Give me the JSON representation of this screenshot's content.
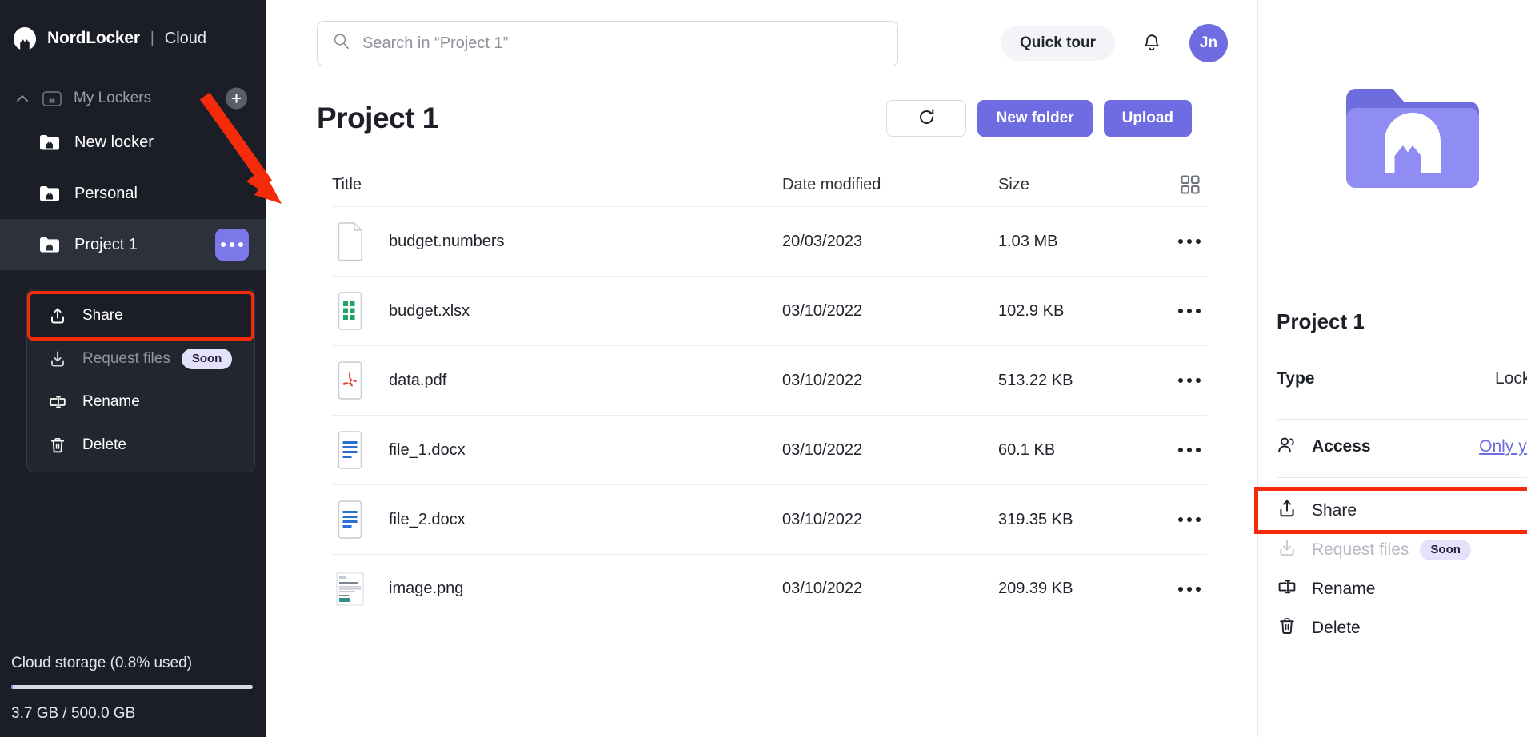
{
  "brand": {
    "name": "NordLocker",
    "separator": "|",
    "product": "Cloud"
  },
  "sidebar": {
    "group": {
      "label": "My Lockers",
      "add_tooltip": "+"
    },
    "lockers": [
      {
        "label": "New locker",
        "active": false
      },
      {
        "label": "Personal",
        "active": false
      },
      {
        "label": "Project 1",
        "active": true
      }
    ],
    "context_menu": [
      {
        "label": "Share",
        "icon": "share-icon",
        "highlighted": true,
        "disabled": false
      },
      {
        "label": "Request files",
        "icon": "download-icon",
        "badge": "Soon",
        "highlighted": false,
        "disabled": true
      },
      {
        "label": "Rename",
        "icon": "rename-icon",
        "highlighted": false,
        "disabled": false
      },
      {
        "label": "Delete",
        "icon": "trash-icon",
        "highlighted": false,
        "disabled": false
      }
    ],
    "storage": {
      "title": "Cloud storage (0.8% used)",
      "used": "3.7 GB",
      "total": "500.0 GB",
      "summary": "3.7 GB / 500.0 GB",
      "percent": 0.8
    }
  },
  "topbar": {
    "search_placeholder": "Search in “Project 1”",
    "search_value": "",
    "quick_tour": "Quick tour",
    "avatar_initials": "Jn"
  },
  "page": {
    "title": "Project 1",
    "refresh_label": "",
    "new_folder_label": "New folder",
    "upload_label": "Upload"
  },
  "table": {
    "columns": [
      "Title",
      "Date modified",
      "Size"
    ],
    "rows": [
      {
        "name": "budget.numbers",
        "date": "20/03/2023",
        "size": "1.03 MB",
        "icon": "numbers-file-icon"
      },
      {
        "name": "budget.xlsx",
        "date": "03/10/2022",
        "size": "102.9 KB",
        "icon": "xlsx-file-icon"
      },
      {
        "name": "data.pdf",
        "date": "03/10/2022",
        "size": "513.22 KB",
        "icon": "pdf-file-icon"
      },
      {
        "name": "file_1.docx",
        "date": "03/10/2022",
        "size": "60.1 KB",
        "icon": "docx-file-icon"
      },
      {
        "name": "file_2.docx",
        "date": "03/10/2022",
        "size": "319.35 KB",
        "icon": "docx-file-icon"
      },
      {
        "name": "image.png",
        "date": "03/10/2022",
        "size": "209.39 KB",
        "icon": "png-file-icon"
      }
    ]
  },
  "details": {
    "name": "Project 1",
    "type_key": "Type",
    "type_value": "Locker",
    "access_label": "Access",
    "access_value": "Only you",
    "actions": [
      {
        "label": "Share",
        "icon": "share-icon",
        "highlighted": true,
        "disabled": false
      },
      {
        "label": "Request files",
        "icon": "download-icon",
        "badge": "Soon",
        "highlighted": false,
        "disabled": true
      },
      {
        "label": "Rename",
        "icon": "rename-icon",
        "highlighted": false,
        "disabled": false
      },
      {
        "label": "Delete",
        "icon": "trash-icon",
        "highlighted": false,
        "disabled": false
      }
    ]
  },
  "colors": {
    "accent": "#6e6ce0",
    "sidebar_bg": "#1b1e26",
    "annotation": "#f42b0b",
    "soon_badge_bg": "#e4e2fb"
  }
}
